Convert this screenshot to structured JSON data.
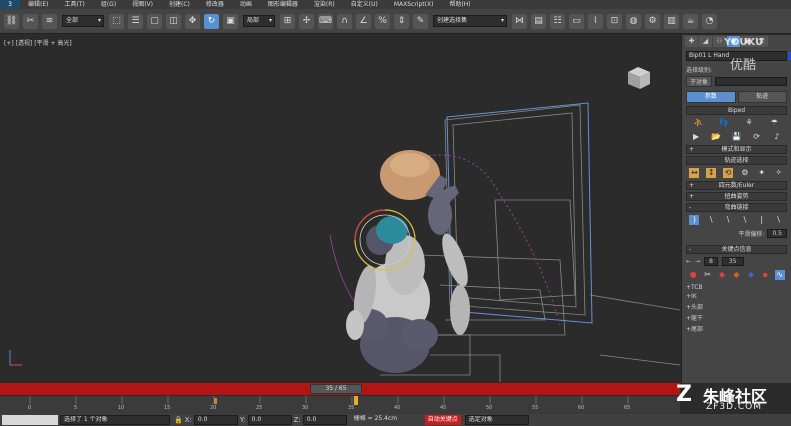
{
  "menubar": {
    "logo": "3",
    "items": [
      "编辑(E)",
      "工具(T)",
      "组(G)",
      "视图(V)",
      "创建(C)",
      "修改器",
      "动画",
      "图形编辑器",
      "渲染(R)",
      "自定义(U)",
      "MAXScript(X)",
      "帮助(H)"
    ]
  },
  "toolbar": {
    "selection_filter": "全部",
    "coord_system": "局部",
    "named_selection": "创建选择集"
  },
  "viewport": {
    "label": "[+] [透视] [平滑 + 高光]"
  },
  "cmdpanel": {
    "object_name": "Bip01 L Hand",
    "selection_level_label": "选择级别:",
    "sub_object_label": "子对象",
    "tab_params": "参数",
    "tab_tracks": "轨迹",
    "rollout_biped": "Biped",
    "rollout_mode_display": "模式和显示",
    "rollout_track_select": "轨迹选择",
    "rollout_quaternion": "四元数/Euler",
    "rollout_twist": "扭曲姿势",
    "rollout_bend": "弯曲链接",
    "smooth_bias_label": "平滑偏移:",
    "smooth_bias_value": "0.5",
    "rollout_key_info": "关键点信息",
    "key_number": "8",
    "key_frame": "35",
    "sub_tcb": "TCB",
    "sub_ik": "IK",
    "sub_head": "头部",
    "sub_body": "躯干",
    "sub_tail": "尾部"
  },
  "timeslider": {
    "position": "35 / 65"
  },
  "trackbar": {
    "ticks": [
      "0",
      "5",
      "10",
      "15",
      "20",
      "25",
      "30",
      "35",
      "40",
      "45",
      "50",
      "55",
      "60",
      "65"
    ]
  },
  "statusbar": {
    "selection_info": "选择了 1 个对象",
    "x_label": "X:",
    "x_value": "0.0",
    "y_label": "Y:",
    "y_value": "0.0",
    "z_label": "Z:",
    "z_value": "0.0",
    "grid_label": "栅格 = 25.4cm",
    "autokey_label": "自动关键点",
    "set_key_filter": "选定对象"
  },
  "watermarks": {
    "youku_top": "YOUKU",
    "youku_bottom": "优酷",
    "zf_logo": "Z",
    "zf_name": "朱峰社区",
    "zf_url": "ZF3D.COM"
  },
  "colors": {
    "accent": "#5a8fd0",
    "timeslider": "#b31414",
    "autokey": "#c81e1e"
  }
}
